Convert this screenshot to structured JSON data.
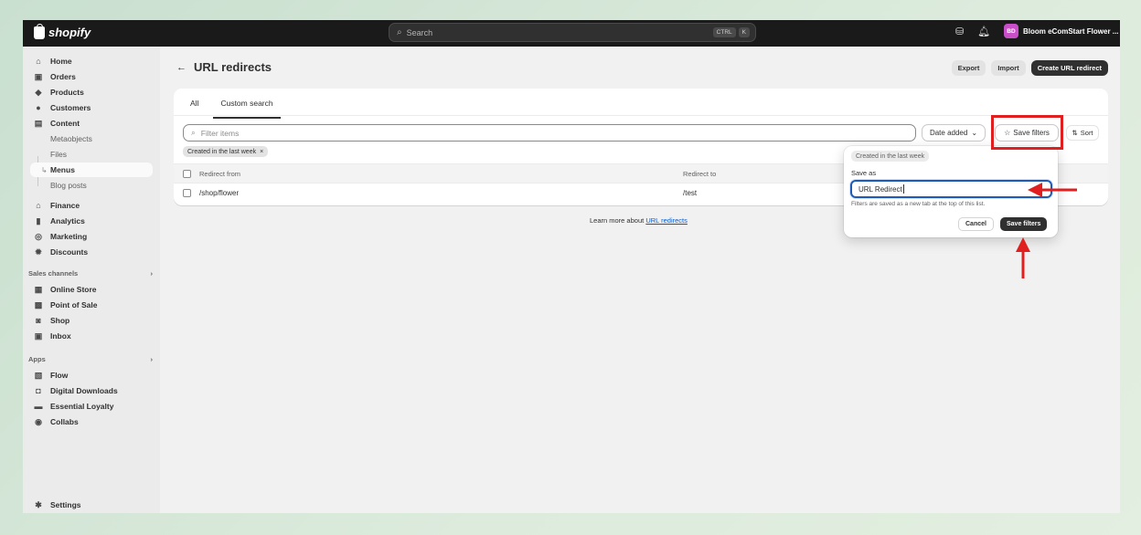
{
  "topbar": {
    "brand": "shopify",
    "search_placeholder": "Search",
    "kbd_1": "CTRL",
    "kbd_2": "K",
    "store_initials": "BD",
    "store_name": "Bloom eComStart Flower ..."
  },
  "sidebar": {
    "items": [
      {
        "label": "Home",
        "icon": "home-icon"
      },
      {
        "label": "Orders",
        "icon": "inbox-icon"
      },
      {
        "label": "Products",
        "icon": "tag-icon"
      },
      {
        "label": "Customers",
        "icon": "person-icon"
      },
      {
        "label": "Content",
        "icon": "content-icon"
      }
    ],
    "content_sub": [
      "Metaobjects",
      "Files",
      "Menus",
      "Blog posts"
    ],
    "items2": [
      {
        "label": "Finance",
        "icon": "bank-icon"
      },
      {
        "label": "Analytics",
        "icon": "chart-bar-icon"
      },
      {
        "label": "Marketing",
        "icon": "target-icon"
      },
      {
        "label": "Discounts",
        "icon": "discount-icon"
      }
    ],
    "sales_channels_label": "Sales channels",
    "sales_channels": [
      "Online Store",
      "Point of Sale",
      "Shop",
      "Inbox"
    ],
    "apps_label": "Apps",
    "apps": [
      "Flow",
      "Digital Downloads",
      "Essential Loyalty",
      "Collabs"
    ],
    "settings": "Settings"
  },
  "page": {
    "title": "URL redirects",
    "export": "Export",
    "import": "Import",
    "create": "Create URL redirect"
  },
  "tabs": [
    "All",
    "Custom search"
  ],
  "filters": {
    "search_placeholder": "Filter items",
    "date_added": "Date added",
    "save_filters": "Save filters",
    "sort": "Sort",
    "applied_chip": "Created in the last week"
  },
  "table": {
    "headers": [
      "Redirect from",
      "Redirect to"
    ],
    "rows": [
      {
        "from": "/shop/flower",
        "to": "/test"
      }
    ]
  },
  "footer": {
    "learn_prefix": "Learn more about",
    "learn_link": "URL redirects"
  },
  "popover": {
    "chip": "Created in the last week",
    "label": "Save as",
    "value": "URL Redirect",
    "help": "Filters are saved as a new tab at the top of this list.",
    "cancel": "Cancel",
    "save": "Save filters"
  },
  "annotation_color": "#e02020"
}
